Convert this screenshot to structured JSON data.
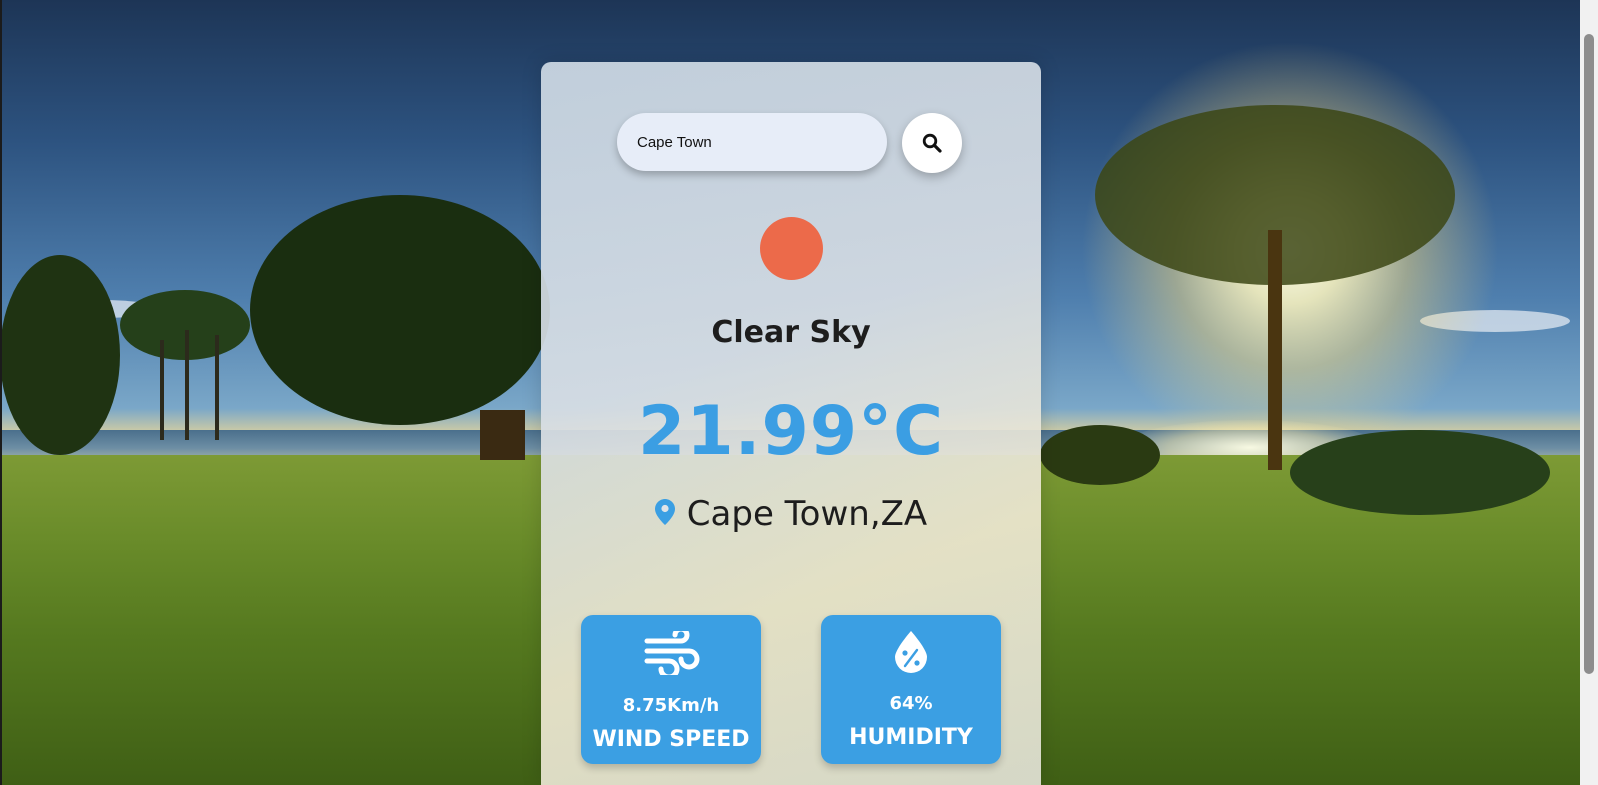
{
  "search": {
    "value": "Cape Town",
    "placeholder": "Cape Town"
  },
  "weather": {
    "description": "Clear Sky",
    "temperature": "21.99°C",
    "location": "Cape Town,ZA"
  },
  "stats": {
    "wind": {
      "value": "8.75Km/h",
      "label": "WIND SPEED"
    },
    "humidity": {
      "value": "64%",
      "label": "HUMIDITY"
    }
  },
  "colors": {
    "accent": "#3b9fe3",
    "weather_icon": "#ec6a4a"
  },
  "icons": {
    "search_button": "search-icon",
    "location": "map-marker-icon",
    "wind": "wind-icon",
    "humidity": "humidity-drop-icon"
  }
}
